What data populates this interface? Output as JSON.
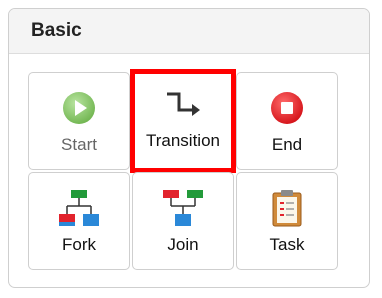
{
  "panel": {
    "title": "Basic"
  },
  "tools": {
    "start": {
      "label": "Start",
      "icon": "play-circle-icon",
      "enabled": false
    },
    "transition": {
      "label": "Transition",
      "icon": "transition-arrow-icon",
      "selected": true
    },
    "end": {
      "label": "End",
      "icon": "stop-circle-icon"
    },
    "fork": {
      "label": "Fork",
      "icon": "fork-icon"
    },
    "join": {
      "label": "Join",
      "icon": "join-icon"
    },
    "task": {
      "label": "Task",
      "icon": "clipboard-task-icon"
    }
  },
  "colors": {
    "selection_border": "#ff0000",
    "start_green": "#8fcc6f",
    "end_red": "#e8141b",
    "node_green": "#229a3a",
    "node_red": "#e2232d",
    "node_blue": "#2a88d8"
  }
}
